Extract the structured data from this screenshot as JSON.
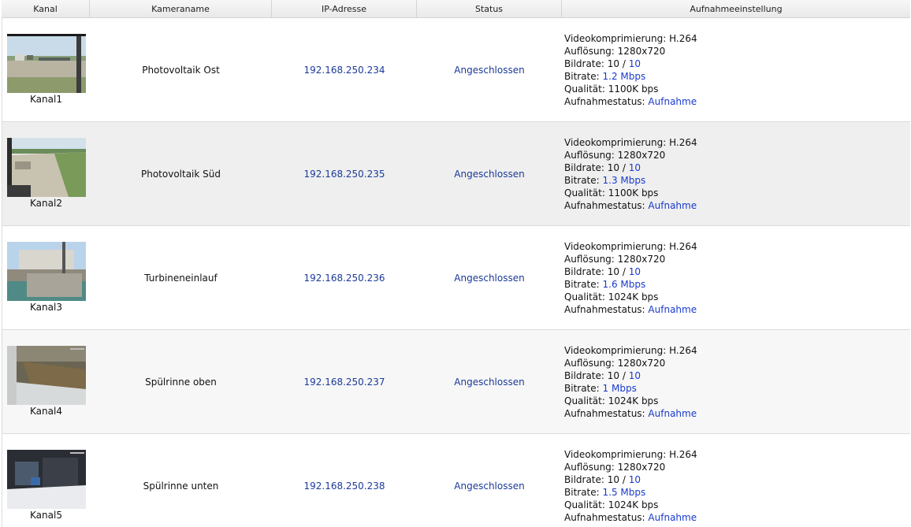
{
  "columns": {
    "kanal": "Kanal",
    "kameraname": "Kameraname",
    "ip": "IP-Adresse",
    "status": "Status",
    "aufnahme": "Aufnahmeeinstellung"
  },
  "labels": {
    "compression": "Videokomprimierung:",
    "resolution": "Auflösung:",
    "framerate": "Bildrate:",
    "bitrate": "Bitrate:",
    "quality": "Qualität:",
    "recstatus": "Aufnahmestatus:"
  },
  "colors": {
    "link": "#1a3acc",
    "ip_text": "#1a3a9a"
  },
  "rows": [
    {
      "channel": "Kanal1",
      "name": "Photovoltaik Ost",
      "ip": "192.168.250.234",
      "status": "Angeschlossen",
      "compression": "H.264",
      "resolution": "1280x720",
      "framerate_value": "10",
      "framerate_sep": " / ",
      "framerate_max": "10",
      "bitrate": "1.2 Mbps",
      "quality": "1100K bps",
      "recstatus": "Aufnahme"
    },
    {
      "channel": "Kanal2",
      "name": "Photovoltaik Süd",
      "ip": "192.168.250.235",
      "status": "Angeschlossen",
      "compression": "H.264",
      "resolution": "1280x720",
      "framerate_value": "10",
      "framerate_sep": " / ",
      "framerate_max": "10",
      "bitrate": "1.3 Mbps",
      "quality": "1100K bps",
      "recstatus": "Aufnahme"
    },
    {
      "channel": "Kanal3",
      "name": "Turbineneinlauf",
      "ip": "192.168.250.236",
      "status": "Angeschlossen",
      "compression": "H.264",
      "resolution": "1280x720",
      "framerate_value": "10",
      "framerate_sep": " / ",
      "framerate_max": "10",
      "bitrate": "1.6 Mbps",
      "quality": "1024K bps",
      "recstatus": "Aufnahme"
    },
    {
      "channel": "Kanal4",
      "name": "Spülrinne oben",
      "ip": "192.168.250.237",
      "status": "Angeschlossen",
      "compression": "H.264",
      "resolution": "1280x720",
      "framerate_value": "10",
      "framerate_sep": " / ",
      "framerate_max": "10",
      "bitrate": "1 Mbps",
      "quality": "1024K bps",
      "recstatus": "Aufnahme"
    },
    {
      "channel": "Kanal5",
      "name": "Spülrinne unten",
      "ip": "192.168.250.238",
      "status": "Angeschlossen",
      "compression": "H.264",
      "resolution": "1280x720",
      "framerate_value": "10",
      "framerate_sep": " / ",
      "framerate_max": "10",
      "bitrate": "1.5 Mbps",
      "quality": "1024K bps",
      "recstatus": "Aufnahme"
    }
  ]
}
